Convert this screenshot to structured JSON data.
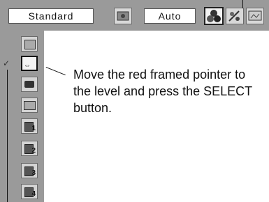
{
  "toolbar": {
    "mode_value": "Standard",
    "auto_value": "Auto",
    "icons": [
      "preset-icon",
      "image-adjust-icon",
      "color-adjust-icon",
      "screen-icon"
    ]
  },
  "menu": {
    "items": [
      {
        "icon": "input-icon",
        "label": ""
      },
      {
        "icon": "pointer-icon",
        "label": ""
      },
      {
        "icon": "camera-icon",
        "label": ""
      },
      {
        "icon": "screen-icon",
        "label": ""
      },
      {
        "icon": "memory-icon",
        "label": "1"
      },
      {
        "icon": "memory-icon",
        "label": "2"
      },
      {
        "icon": "memory-icon",
        "label": "3"
      },
      {
        "icon": "memory-icon",
        "label": "4"
      }
    ]
  },
  "callout": {
    "text": "Move the red framed pointer to the level and press the SELECT button."
  }
}
